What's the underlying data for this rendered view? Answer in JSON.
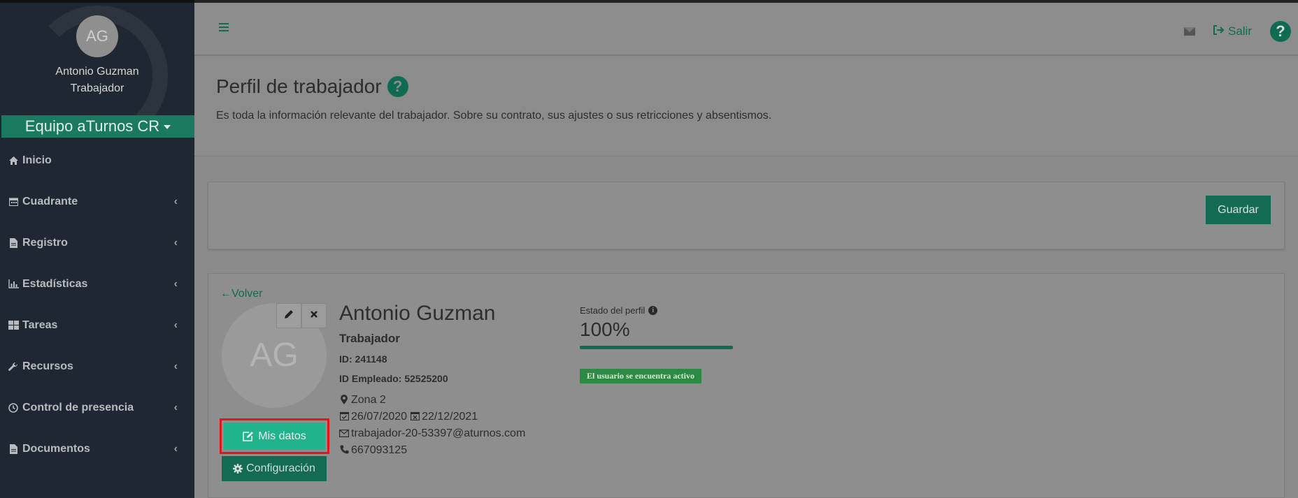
{
  "sidebar": {
    "avatar_initials": "AG",
    "user_name": "Antonio Guzman",
    "user_role": "Trabajador",
    "team": "Equipo aTurnos CR",
    "items": [
      {
        "label": "Inicio",
        "icon": "home-icon",
        "has_submenu": false
      },
      {
        "label": "Cuadrante",
        "icon": "calendar-icon",
        "has_submenu": true
      },
      {
        "label": "Registro",
        "icon": "file-icon",
        "has_submenu": true
      },
      {
        "label": "Estadísticas",
        "icon": "bar-chart-icon",
        "has_submenu": true
      },
      {
        "label": "Tareas",
        "icon": "grid-icon",
        "has_submenu": true
      },
      {
        "label": "Recursos",
        "icon": "wrench-icon",
        "has_submenu": true
      },
      {
        "label": "Control de presencia",
        "icon": "clock-icon",
        "has_submenu": true
      },
      {
        "label": "Documentos",
        "icon": "file-icon",
        "has_submenu": true
      }
    ],
    "chevron": "‹"
  },
  "header": {
    "logout_label": "Salir",
    "help_label": "?"
  },
  "page": {
    "title": "Perfil de trabajador",
    "help_label": "?",
    "description": "Es toda la información relevante del trabajador. Sobre su contrato, sus ajustes o sus retricciones y absentismos."
  },
  "save_panel": {
    "save_label": "Guardar"
  },
  "profile": {
    "back_label": "Volver",
    "avatar_initials": "AG",
    "edit_label": "Mis datos",
    "config_label": "Configuración",
    "name": "Antonio Guzman",
    "role": "Trabajador",
    "id_line": "ID: 241148",
    "employee_id_line": "ID Empleado: 52525200",
    "zone": "Zona 2",
    "start_date": "26/07/2020",
    "end_date": "22/12/2021",
    "email": "trabajador-20-53397@aturnos.com",
    "phone": "667093125",
    "status_label": "Estado del perfil",
    "status_percent_text": "100%",
    "status_progress": 1.0,
    "active_badge": "El usuario se encuentra activo"
  },
  "colors": {
    "brand_green": "#0f6b51",
    "button_teal": "#20b38c",
    "highlight_red": "#e0161c",
    "sidebar_bg": "#1f2832"
  }
}
